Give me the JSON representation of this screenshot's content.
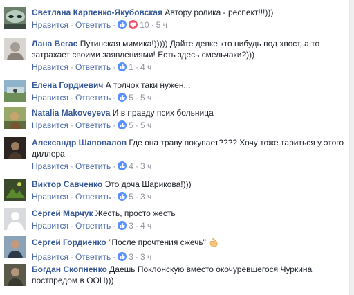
{
  "action_labels": {
    "like": "Нравится",
    "reply": "Ответить"
  },
  "comments": [
    {
      "author": "Светлана Карпенко-Якубовская",
      "text": "Автору ролика - респект!!!)))",
      "likes": "10",
      "time": "5 ч",
      "reactions": [
        "like-icon",
        "heart-icon"
      ]
    },
    {
      "author": "Лана Вегас",
      "text": "Путинская мимика!))))) Дайте девке кто нибудь под хвост, а то затрахает своими заявлениями! Есть здесь смельчаки?)))",
      "likes": "1",
      "time": "4 ч",
      "reactions": [
        "like-icon"
      ]
    },
    {
      "author": "Елена Гордиевич",
      "text": "А толчок таки нужен...",
      "likes": "5",
      "time": "5 ч",
      "reactions": [
        "like-icon"
      ]
    },
    {
      "author": "Natalia Makoveyeva",
      "text": "И в правду псих больница",
      "likes": "5",
      "time": "5 ч",
      "reactions": [
        "like-icon"
      ]
    },
    {
      "author": "Александр Шаповалов",
      "text": "Где она траву покупает???? Хочу тоже тариться у этого диллера",
      "likes": "4",
      "time": "3 ч",
      "reactions": [
        "like-icon"
      ]
    },
    {
      "author": "Виктор Савченко",
      "text": "Это доча Шарикова!)))",
      "likes": "5",
      "time": "3 ч",
      "reactions": [
        "like-icon"
      ]
    },
    {
      "author": "Сергей Марчук",
      "text": "Жесть, просто жесть",
      "likes": "3",
      "time": "4 ч",
      "reactions": [
        "like-icon"
      ]
    },
    {
      "author": "Сергей Гордиенко",
      "text": "\"После прочтения сжечь\"",
      "likes": "3",
      "time": "3 ч",
      "reactions": [
        "like-icon"
      ],
      "emoji": "pointing-hand-emoji"
    },
    {
      "author": "Богдан Скопненко",
      "text": "Даешь Поклонскую вместо окочуревшегося Чуркина постпредом в ООН)))",
      "likes": "",
      "time": "",
      "reactions": []
    }
  ],
  "colors": {
    "author": "#365899",
    "link": "#4b6aa6",
    "meta": "#90949c",
    "like": "#5890ff",
    "love": "#f25268"
  }
}
